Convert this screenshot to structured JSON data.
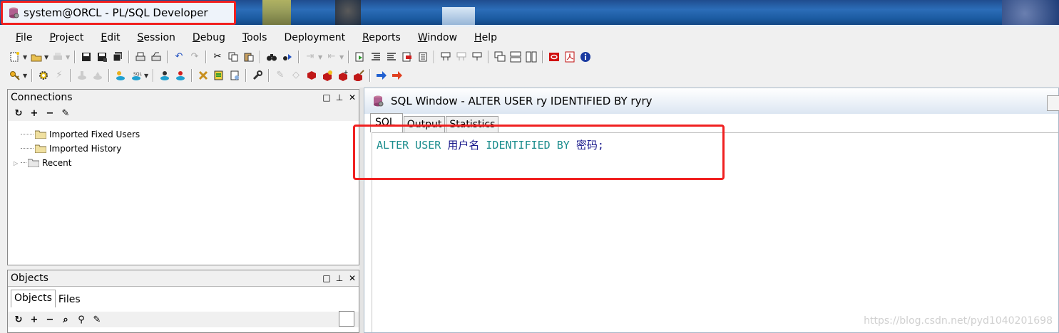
{
  "window": {
    "title": "system@ORCL - PL/SQL Developer"
  },
  "menu": [
    {
      "first": "F",
      "rest": "ile"
    },
    {
      "first": "P",
      "rest": "roject"
    },
    {
      "first": "E",
      "rest": "dit"
    },
    {
      "first": "S",
      "rest": "ession"
    },
    {
      "first": "D",
      "rest": "ebug"
    },
    {
      "first": "T",
      "rest": "ools"
    },
    {
      "first": "",
      "rest": "Deployment"
    },
    {
      "first": "R",
      "rest": "eports"
    },
    {
      "first": "W",
      "rest": "indow"
    },
    {
      "first": "H",
      "rest": "elp"
    }
  ],
  "connections": {
    "title": "Connections",
    "tree": [
      "Imported Fixed Users",
      "Imported History",
      "Recent"
    ]
  },
  "objects": {
    "title": "Objects",
    "tabs": [
      "Objects",
      "Files"
    ]
  },
  "sql_window": {
    "title": "SQL Window - ALTER USER ry IDENTIFIED BY ryry",
    "tabs": [
      "SQL",
      "Output",
      "Statistics"
    ],
    "code": {
      "kw1": "ALTER USER",
      "user": "用户名",
      "kw2": "IDENTIFIED BY",
      "pwd": "密码",
      "end": ";"
    }
  },
  "watermark": "https://blog.csdn.net/pyd1040201698",
  "colors": {
    "annotation_red": "#f02020",
    "sql_keyword": "#1a8c8c",
    "sql_identifier": "#1a1a8c"
  }
}
